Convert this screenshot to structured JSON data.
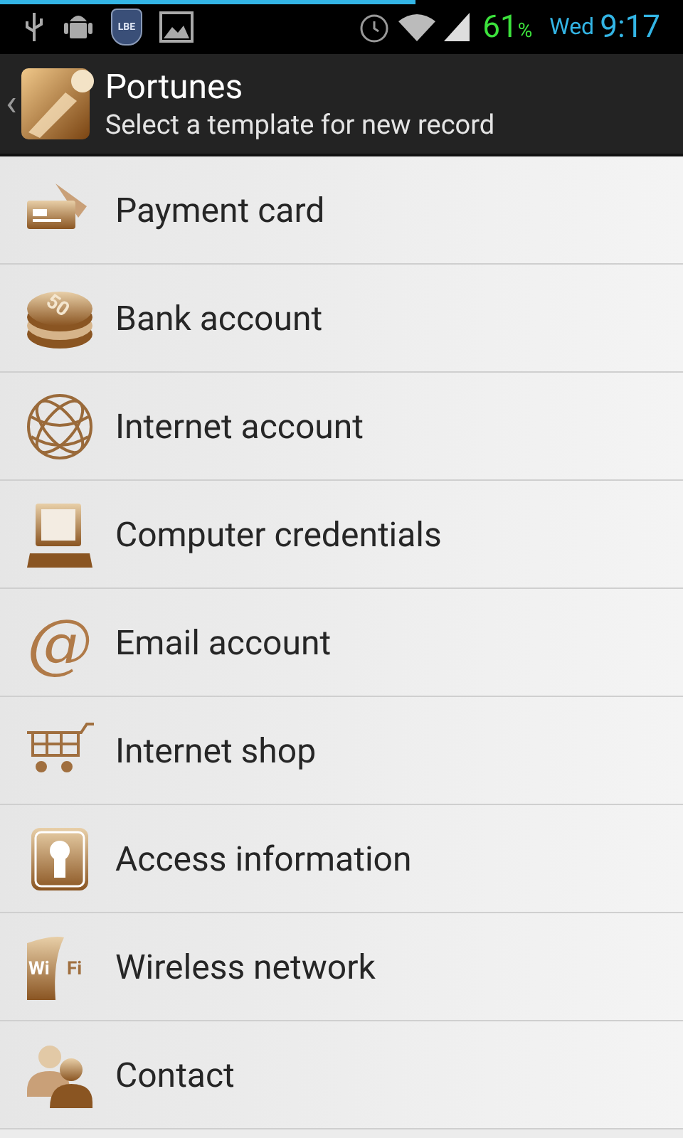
{
  "status_bar": {
    "notification_icons": [
      {
        "kind": "usb"
      },
      {
        "kind": "android"
      },
      {
        "kind": "shield",
        "text": "LBE"
      },
      {
        "kind": "image"
      }
    ],
    "battery": "61",
    "battery_unit": "%",
    "day": "Wed",
    "time": "9:17"
  },
  "header": {
    "title": "Portunes",
    "subtitle": "Select a template for new record",
    "back": "‹"
  },
  "templates": [
    {
      "label": "Payment card",
      "kind": "card"
    },
    {
      "label": "Bank account",
      "kind": "coins",
      "icon_text": "50"
    },
    {
      "label": "Internet account",
      "kind": "globe"
    },
    {
      "label": "Computer credentials",
      "kind": "computer"
    },
    {
      "label": "Email account",
      "kind": "at",
      "icon_text": "@"
    },
    {
      "label": "Internet shop",
      "kind": "cart"
    },
    {
      "label": "Access information",
      "kind": "keyhole"
    },
    {
      "label": "Wireless network",
      "kind": "wifi",
      "icon_text": "Wi",
      "icon_text2": "Fi"
    },
    {
      "label": "Contact",
      "kind": "people"
    }
  ]
}
